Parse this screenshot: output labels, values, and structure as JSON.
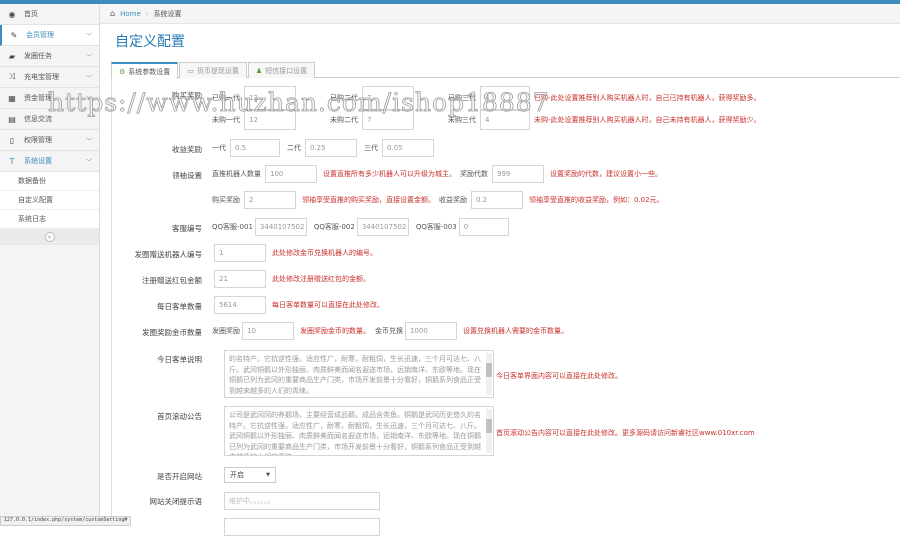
{
  "sidebar": {
    "items": [
      {
        "label": "首页",
        "icon": "dashboard-icon"
      },
      {
        "label": "会员管理",
        "icon": "edit-icon"
      },
      {
        "label": "发圈任务",
        "icon": "book-icon"
      },
      {
        "label": "充电宝管理",
        "icon": "shuffle-icon"
      },
      {
        "label": "资金管理",
        "icon": "calendar-icon"
      },
      {
        "label": "信息交流",
        "icon": "list-icon"
      },
      {
        "label": "权限管理",
        "icon": "file-icon"
      },
      {
        "label": "系统设置",
        "icon": "text-icon"
      }
    ],
    "sub": [
      "数据备份",
      "自定义配置",
      "系统日志"
    ],
    "collapse": "«"
  },
  "breadcrumb": {
    "home": "Home",
    "current": "系统设置"
  },
  "title": "自定义配置",
  "tabs": [
    "系统参数设置",
    "货币提现设置",
    "短信接口设置"
  ],
  "form": {
    "buy": {
      "label": "购买奖励",
      "row1": [
        {
          "l": "已购一代",
          "v": "12"
        },
        {
          "l": "已购二代",
          "v": "7"
        },
        {
          "l": "已购三代",
          "v": "4"
        }
      ],
      "hint1": "已购-此处设置推荐别人购买机器人时，自己已持有机器人，获得奖励多。",
      "row2": [
        {
          "l": "未购一代",
          "v": "12"
        },
        {
          "l": "未购二代",
          "v": "7"
        },
        {
          "l": "未购三代",
          "v": "4"
        }
      ],
      "hint2": "未购-此处设置推荐别人购买机器人时，自己未持有机器人，获得奖励少。"
    },
    "income": {
      "label": "收益奖励",
      "items": [
        {
          "l": "一代",
          "v": "0.5"
        },
        {
          "l": "二代",
          "v": "0.25"
        },
        {
          "l": "三代",
          "v": "0.05"
        }
      ]
    },
    "leader": {
      "label": "领袖设置",
      "count_l": "直推机器人数量",
      "count_v": "100",
      "count_hint": "设置直推所有多少机器人可以升级为城主。",
      "gen_l": "奖励代数",
      "gen_v": "999",
      "gen_hint": "设置奖励的代数，建议设置小一些。",
      "buy_l": "购买奖励",
      "buy_v": "2",
      "buy_hint": "领袖享受直推的购买奖励，直接设置金额。",
      "inc_l": "收益奖励",
      "inc_v": "0.2",
      "inc_hint": "领袖享受直推的收益奖励，例如：0.02元。"
    },
    "qq": {
      "label": "客服编号",
      "items": [
        {
          "l": "QQ客服-001",
          "v": "3440107502"
        },
        {
          "l": "QQ客服-002",
          "v": "3440107502"
        },
        {
          "l": "QQ客服-003",
          "v": "0"
        }
      ]
    },
    "robot": {
      "label": "发圈赠送机器人编号",
      "v": "1",
      "hint": "此处修改金币兑换机器人的编号。"
    },
    "redpack": {
      "label": "注册赠送红包金额",
      "v": "21",
      "hint": "此处修改注册赠送红包的金额。"
    },
    "orders": {
      "label": "每日客单数量",
      "v": "5614",
      "hint": "每日客单数量可以直接在此处修改。"
    },
    "coins": {
      "label": "发圈奖励金币数量",
      "l1": "发圈奖励",
      "v1": "10",
      "hint1": "发圈奖励金币的数量。",
      "l2": "金币兑换",
      "v2": "1000",
      "hint2": "设置兑换机器人需要的金币数量。"
    },
    "desc": {
      "label": "今日客单说明",
      "v": "的名特产。它抗逆性强，适应性广，耐寒，耐粗饲，生长迅速，三个月可达七、八斤。武冈铜鹅以外形独丽、肉质鲜美而闻名遐迩市场，远销南洋、东欧等地。现在铜鹅已列为武冈的重要商品生产门类，市场开发前景十分看好，铜鹅系列食品正受到越来越多的人们的青睐。",
      "hint": "今日客单界面内容可以直接在此处修改。"
    },
    "notice": {
      "label": "首页滚动公告",
      "v": "公司是武冈冈的养鹅场，主要经营成品鹅，成品含类鱼。铜鹅是武冈历史悠久的名特产。它抗逆性强，适应性广，耐寒，耐粗饲，生长迅速，三个月可达七、八斤。武冈铜鹅以外形独丽、肉质鲜美而闻名遐迩市场，远销南洋、东欧等地。现在铜鹅已列为武冈的重要商品生产门类，市场开发前景十分看好，铜鹅系列食品正受到越来越多的人们的青睐。",
      "hint": "首页滚动公告内容可以直接在此处修改。更多源码请访问新睿社区www.010xr.com"
    },
    "open": {
      "label": "是否开启网站",
      "v": "开启"
    },
    "closemsg": {
      "label": "网站关闭提示语",
      "placeholder": "维护中。。。。。。"
    }
  },
  "status_url": "127.0.0.1/index.php/system/customSetting#",
  "watermark": "https://www.huzhan.com/ishop18887"
}
